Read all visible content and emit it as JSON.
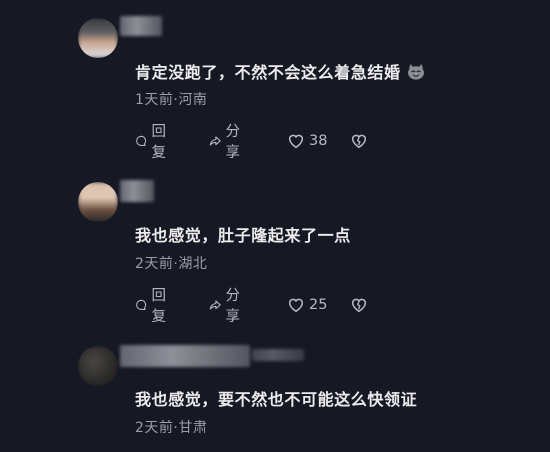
{
  "comments": [
    {
      "text": "肯定没跑了，不然不会这么着急结婚",
      "meta": "1天前·河南",
      "reply_label": "回复",
      "share_label": "分享",
      "likes": "38",
      "has_emoji": true
    },
    {
      "text": "我也感觉，肚子隆起来了一点",
      "meta": "2天前·湖北",
      "reply_label": "回复",
      "share_label": "分享",
      "likes": "25"
    },
    {
      "text": "我也感觉，要不然也不可能这么快领证",
      "meta": "2天前·甘肃"
    }
  ],
  "icons": {
    "reply": "reply-icon",
    "share": "share-icon",
    "like": "heart-icon",
    "dislike": "broken-heart-icon",
    "emoji": "smiling-cat-emoji-icon"
  },
  "colors": {
    "background": "#161823",
    "text": "#ececee",
    "meta": "#9a9ca6",
    "action": "#b6b8c0"
  }
}
